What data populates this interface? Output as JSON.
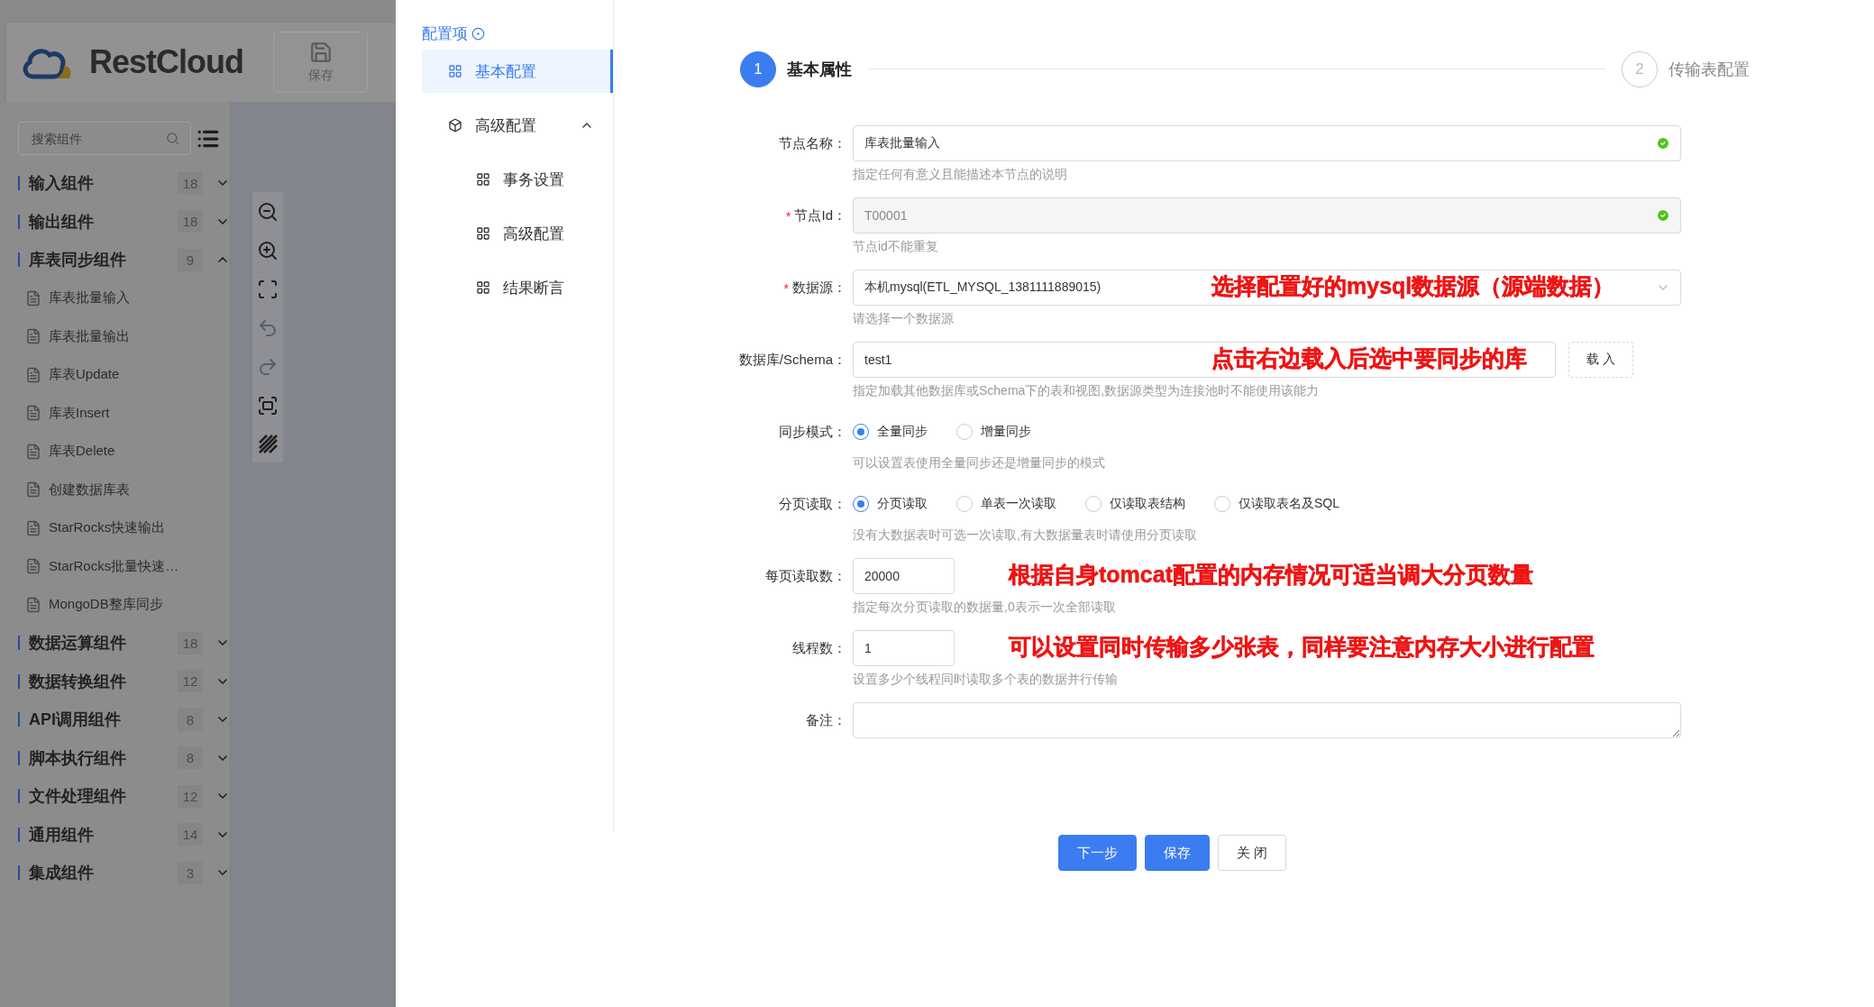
{
  "app": {
    "logo": "RestCloud",
    "toolbar": [
      {
        "label": "保存"
      }
    ],
    "search": {
      "placeholder": "搜索组件"
    },
    "groups": [
      {
        "label": "输入组件",
        "count": "18",
        "expanded": false
      },
      {
        "label": "输出组件",
        "count": "18",
        "expanded": false
      },
      {
        "label": "库表同步组件",
        "count": "9",
        "expanded": true,
        "children": [
          {
            "label": "库表批量输入"
          },
          {
            "label": "库表批量输出"
          },
          {
            "label": "库表Update"
          },
          {
            "label": "库表Insert"
          },
          {
            "label": "库表Delete"
          },
          {
            "label": "创建数据库表"
          },
          {
            "label": "StarRocks快速输出"
          },
          {
            "label": "StarRocks批量快速…"
          },
          {
            "label": "MongoDB整库同步"
          }
        ]
      },
      {
        "label": "数据运算组件",
        "count": "18",
        "expanded": false
      },
      {
        "label": "数据转换组件",
        "count": "12",
        "expanded": false
      },
      {
        "label": "API调用组件",
        "count": "8",
        "expanded": false
      },
      {
        "label": "脚本执行组件",
        "count": "8",
        "expanded": false
      },
      {
        "label": "文件处理组件",
        "count": "12",
        "expanded": false
      },
      {
        "label": "通用组件",
        "count": "14",
        "expanded": false
      },
      {
        "label": "集成组件",
        "count": "3",
        "expanded": false
      }
    ]
  },
  "config_menu": {
    "title": "配置项",
    "items": [
      {
        "label": "基本配置",
        "selected": true
      },
      {
        "label": "高级配置",
        "selected": false,
        "expanded": true,
        "children": [
          {
            "label": "事务设置",
            "selected": false
          },
          {
            "label": "高级配置",
            "selected": false
          },
          {
            "label": "结果断言",
            "selected": false
          }
        ]
      }
    ]
  },
  "steps": [
    {
      "number": "1",
      "label": "基本属性",
      "active": true
    },
    {
      "number": "2",
      "label": "传输表配置",
      "active": false
    }
  ],
  "fields": [
    {
      "kind": "text",
      "label": "节点名称：",
      "value": "库表批量输入",
      "valid": true,
      "disabled": false,
      "help": "指定任何有意义且能描述本节点的说明"
    },
    {
      "kind": "text",
      "label": "节点Id：",
      "required_mark": "*",
      "value": "T00001",
      "valid": true,
      "disabled": true,
      "help": "节点id不能重复"
    },
    {
      "kind": "select",
      "label": "数据源：",
      "required_mark": "*",
      "value": "本机mysql(ETL_MYSQL_1381111889015)",
      "help": "请选择一个数据源",
      "annotation": "选择配置好的mysql数据源（源端数据）"
    },
    {
      "kind": "text_button",
      "label": "数据库/Schema：",
      "value": "test1",
      "button": "载 入",
      "help": "指定加载其他数据库或Schema下的表和视图,数据源类型为连接池时不能使用该能力",
      "annotation": "点击右边载入后选中要同步的库"
    },
    {
      "kind": "radio",
      "label": "同步模式：",
      "options": [
        {
          "label": "全量同步",
          "selected": true
        },
        {
          "label": "增量同步",
          "selected": false
        }
      ],
      "help": "可以设置表使用全量同步还是增量同步的模式"
    },
    {
      "kind": "radio",
      "label": "分页读取：",
      "options": [
        {
          "label": "分页读取",
          "selected": true
        },
        {
          "label": "单表一次读取",
          "selected": false
        },
        {
          "label": "仅读取表结构",
          "selected": false
        },
        {
          "label": "仅读取表名及SQL",
          "selected": false
        }
      ],
      "help": "没有大数据表时可选一次读取,有大数据量表时请使用分页读取"
    },
    {
      "kind": "short",
      "label": "每页读取数：",
      "value": "20000",
      "help": "指定每次分页读取的数据量,0表示一次全部读取",
      "annotation": "根据自身tomcat配置的内存情况可适当调大分页数量"
    },
    {
      "kind": "short",
      "label": "线程数：",
      "value": "1",
      "help": "设置多少个线程同时读取多个表的数据并行传输",
      "annotation": "可以设置同时传输多少张表，同样要注意内存大小进行配置"
    },
    {
      "kind": "textarea",
      "label": "备注："
    }
  ],
  "buttons": [
    {
      "label": "下一步",
      "primary": true
    },
    {
      "label": "保存",
      "primary": true
    },
    {
      "label": "关 闭",
      "primary": false
    }
  ]
}
